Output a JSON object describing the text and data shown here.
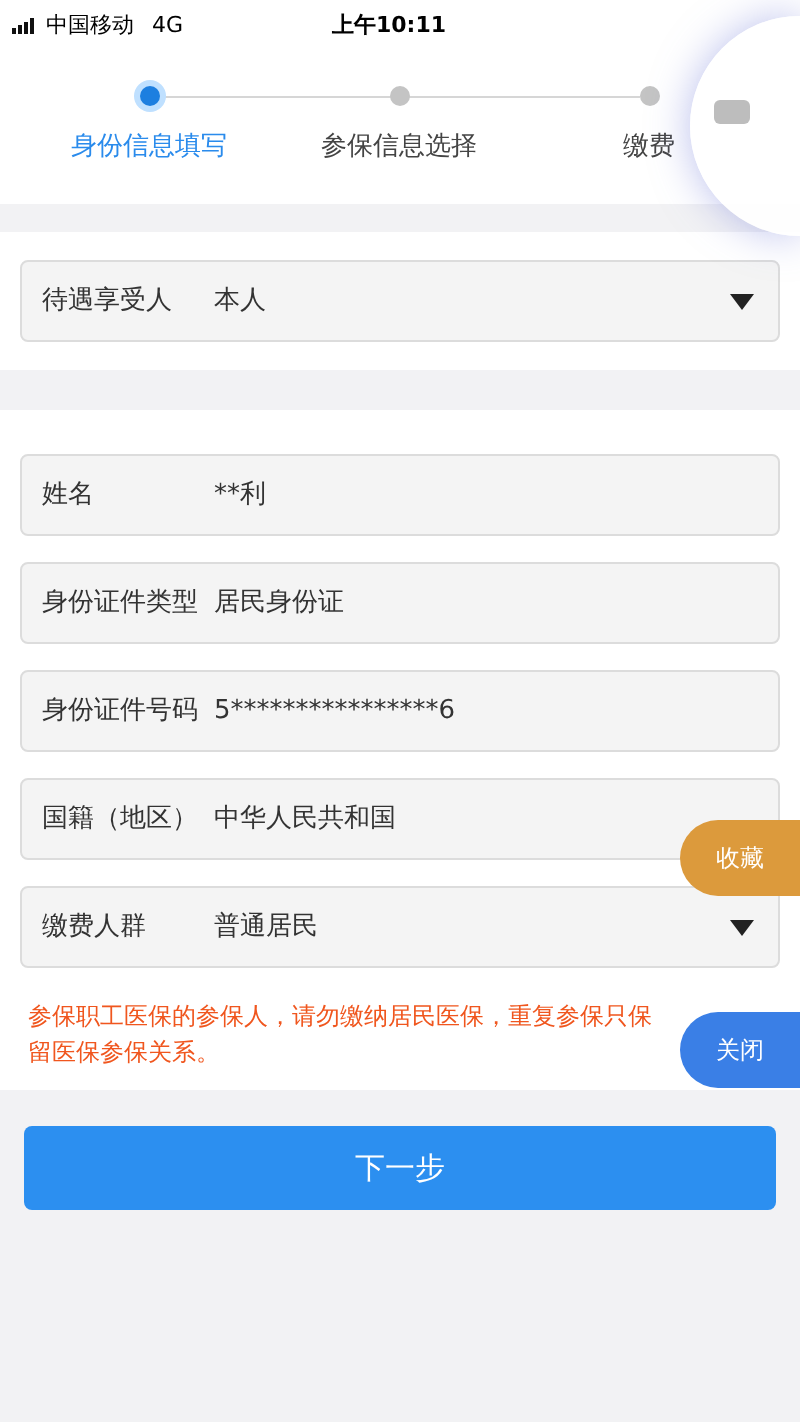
{
  "status_bar": {
    "carrier": "中国移动",
    "network": "4G",
    "time": "上午10:11"
  },
  "steps": [
    {
      "label": "身份信息填写",
      "selected": true
    },
    {
      "label": "参保信息选择",
      "selected": false
    },
    {
      "label": "缴费",
      "selected": false
    }
  ],
  "beneficiary": {
    "label": "待遇享受人",
    "value": "本人",
    "kind": "dropdown"
  },
  "fields": [
    {
      "label": "姓名",
      "value": "**利",
      "kind": "text"
    },
    {
      "label": "身份证件类型",
      "value": "居民身份证",
      "kind": "text"
    },
    {
      "label": "身份证件号码",
      "value": "5****************6",
      "kind": "text"
    },
    {
      "label": "国籍（地区）",
      "value": "中华人民共和国",
      "kind": "text"
    },
    {
      "label": "缴费人群",
      "value": "普通居民",
      "kind": "dropdown"
    }
  ],
  "warning": "参保职工医保的参保人，请勿缴纳居民医保，重复参保只保留医保参保关系。",
  "next_button": "下一步",
  "float_buttons": [
    {
      "label": "收藏",
      "color": "#dc9a3c"
    },
    {
      "label": "关闭",
      "color": "#3a7fe6"
    }
  ]
}
